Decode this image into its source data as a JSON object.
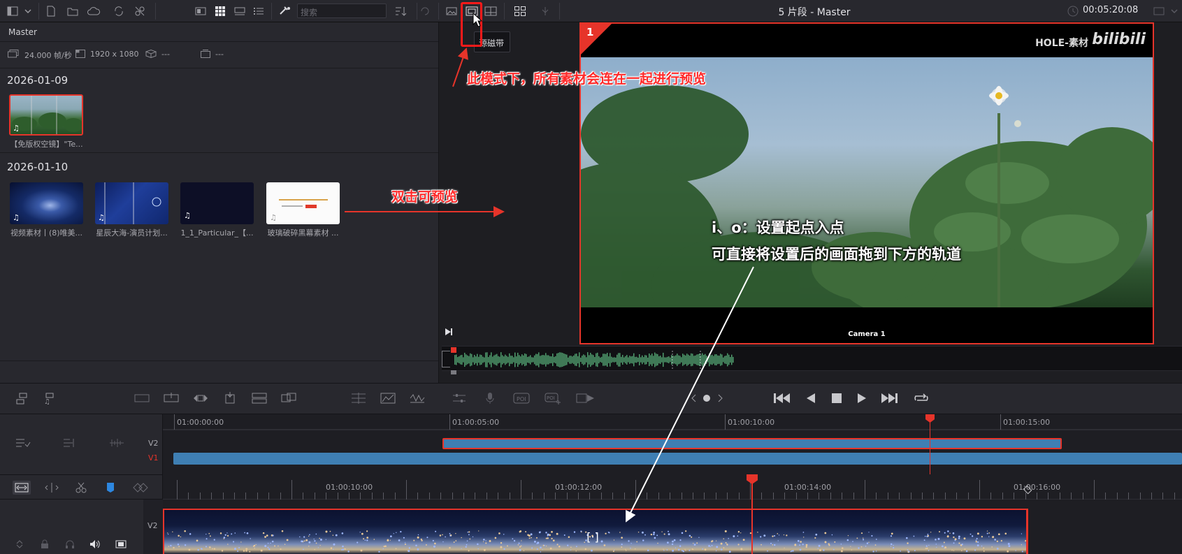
{
  "header": {
    "search_placeholder": "搜索",
    "title": "5 片段 - Master",
    "timecode": "00:05:20:08"
  },
  "tooltip": "源磁带",
  "media_pool": {
    "bin_name": "Master",
    "meta": {
      "fps": "24.000 帧/秒",
      "resolution": "1920 x 1080",
      "codec": "---",
      "audio": "---"
    },
    "groups": [
      {
        "date": "2026-01-09",
        "clips": [
          {
            "label": "【免版权空镜】\"Te..."
          }
        ]
      },
      {
        "date": "2026-01-10",
        "clips": [
          {
            "label": "视频素材丨(8)唯美..."
          },
          {
            "label": "星辰大海-演员计划..."
          },
          {
            "label": "1_1_Particular_【..."
          },
          {
            "label": "玻璃破碎黑幕素材 ..."
          }
        ]
      }
    ]
  },
  "viewer": {
    "clip_number": "1",
    "watermark": "HOLE-素材",
    "watermark_logo": "bilibili",
    "camera_label": "Camera 1"
  },
  "annotations": {
    "mode_note": "此模式下，所有素材会连在一起进行预览",
    "double_click_note": "双击可预览",
    "io_note_line1": "i、o：设置起点入点",
    "io_note_line2": "可直接将设置后的画面拖到下方的轨道"
  },
  "upper_timeline": {
    "timecodes": [
      "01:00:00:00",
      "01:00:05:00",
      "01:00:10:00",
      "01:00:15:00"
    ],
    "tracks": [
      "V2",
      "V1"
    ]
  },
  "lower_timeline": {
    "timecodes": [
      "01:00:10:00",
      "01:00:12:00",
      "01:00:14:00",
      "01:00:16:00"
    ],
    "tracks": [
      "V2"
    ]
  },
  "colors": {
    "accent_red": "#e6342a",
    "clip_blue": "#3f7fb3",
    "waveform_green": "#4f9c6d"
  }
}
